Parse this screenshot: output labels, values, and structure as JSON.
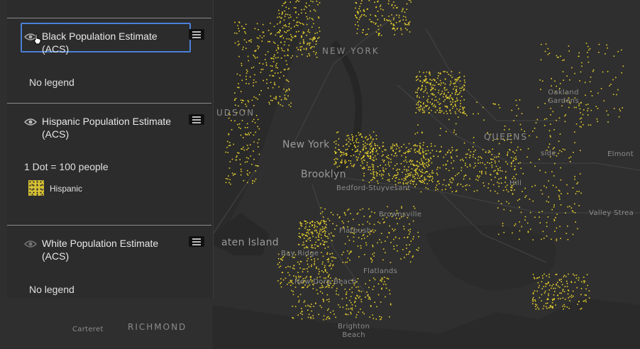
{
  "map": {
    "background_color": "#2f2f2f",
    "dot_color": "#e6cf2d",
    "labels": {
      "new_york_upper": "NEW YORK",
      "hudson": "UDSON",
      "new_york": "New York",
      "brooklyn": "Brooklyn",
      "bedford_stuyvesant": "Bedford-Stuyvesant",
      "brownsville": "Brownsville",
      "flatbush": "Flatbush",
      "flatlands": "Flatlands",
      "bay_ridge": "Bay Ridge",
      "new_dorp": "New Dorp Beach",
      "staten_island": "aten Island",
      "carteret": "Carteret",
      "richmond": "RICHMOND",
      "brighton_beach": "Brighton\nBeach",
      "queens": "QUEENS",
      "oakland_gardens": "Oakland\nGardens",
      "elmont": "Elmont",
      "valley_stream": "Valley Strea",
      "forest_hill": "Hill",
      "hillside": "side"
    }
  },
  "panel": {
    "layers": [
      {
        "title": "Black Population Estimate (ACS)",
        "legend_text": "No legend",
        "visible_icon": "eye-icon",
        "menu_icon": "legend-list-icon",
        "focused": true
      },
      {
        "title": "Hispanic Population Estimate (ACS)",
        "dot_rule": "1 Dot = 100 people",
        "legend_item": "Hispanic",
        "swatch_color": "#d8c233",
        "visible_icon": "eye-icon",
        "menu_icon": "legend-list-icon"
      },
      {
        "title": "White Population Estimate (ACS)",
        "legend_text": "No legend",
        "visible_icon": "eye-icon",
        "menu_icon": "legend-list-icon"
      }
    ]
  }
}
